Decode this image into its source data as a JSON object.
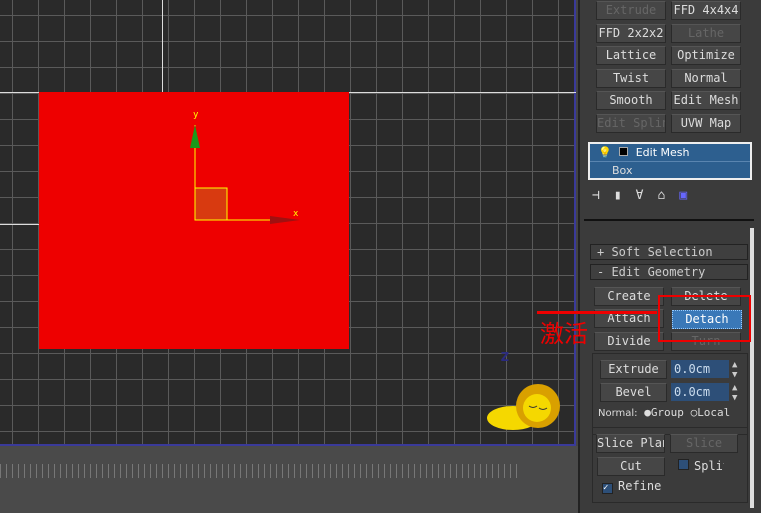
{
  "modifiers": [
    {
      "label": "Extrude",
      "enabled": false
    },
    {
      "label": "FFD 4x4x4",
      "enabled": true
    },
    {
      "label": "FFD 2x2x2",
      "enabled": true
    },
    {
      "label": "Lathe",
      "enabled": false
    },
    {
      "label": "Lattice",
      "enabled": true
    },
    {
      "label": "Optimize",
      "enabled": true
    },
    {
      "label": "Twist",
      "enabled": true
    },
    {
      "label": "Normal",
      "enabled": true
    },
    {
      "label": "Smooth",
      "enabled": true
    },
    {
      "label": "Edit Mesh",
      "enabled": true
    },
    {
      "label": "Edit Spline",
      "enabled": false
    },
    {
      "label": "UVW Map",
      "enabled": true
    }
  ],
  "stack": {
    "top": "Edit Mesh",
    "base": "Box"
  },
  "rollouts": {
    "soft": "+  Soft Selection",
    "edit": "-  Edit Geometry"
  },
  "geometry": {
    "create": "Create",
    "delete": "Delete",
    "attach": "Attach",
    "detach": "Detach",
    "divide": "Divide",
    "turn": "Turn",
    "extrude": "Extrude",
    "extrude_val": "0.0cm",
    "bevel": "Bevel",
    "bevel_val": "0.0cm",
    "normal": "Normal:",
    "group": "Group",
    "local": "Local",
    "slice_plane": "Slice Plane",
    "slice": "Slice",
    "cut": "Cut",
    "split": "Split",
    "refine": "Refine"
  },
  "viewport": {
    "axis_x": "x",
    "axis_y": "y",
    "axis_z": "z"
  },
  "annotation": "激活",
  "colors": {
    "box": "#ee0000",
    "active": "#3a78b8",
    "annotation": "#e00000"
  }
}
